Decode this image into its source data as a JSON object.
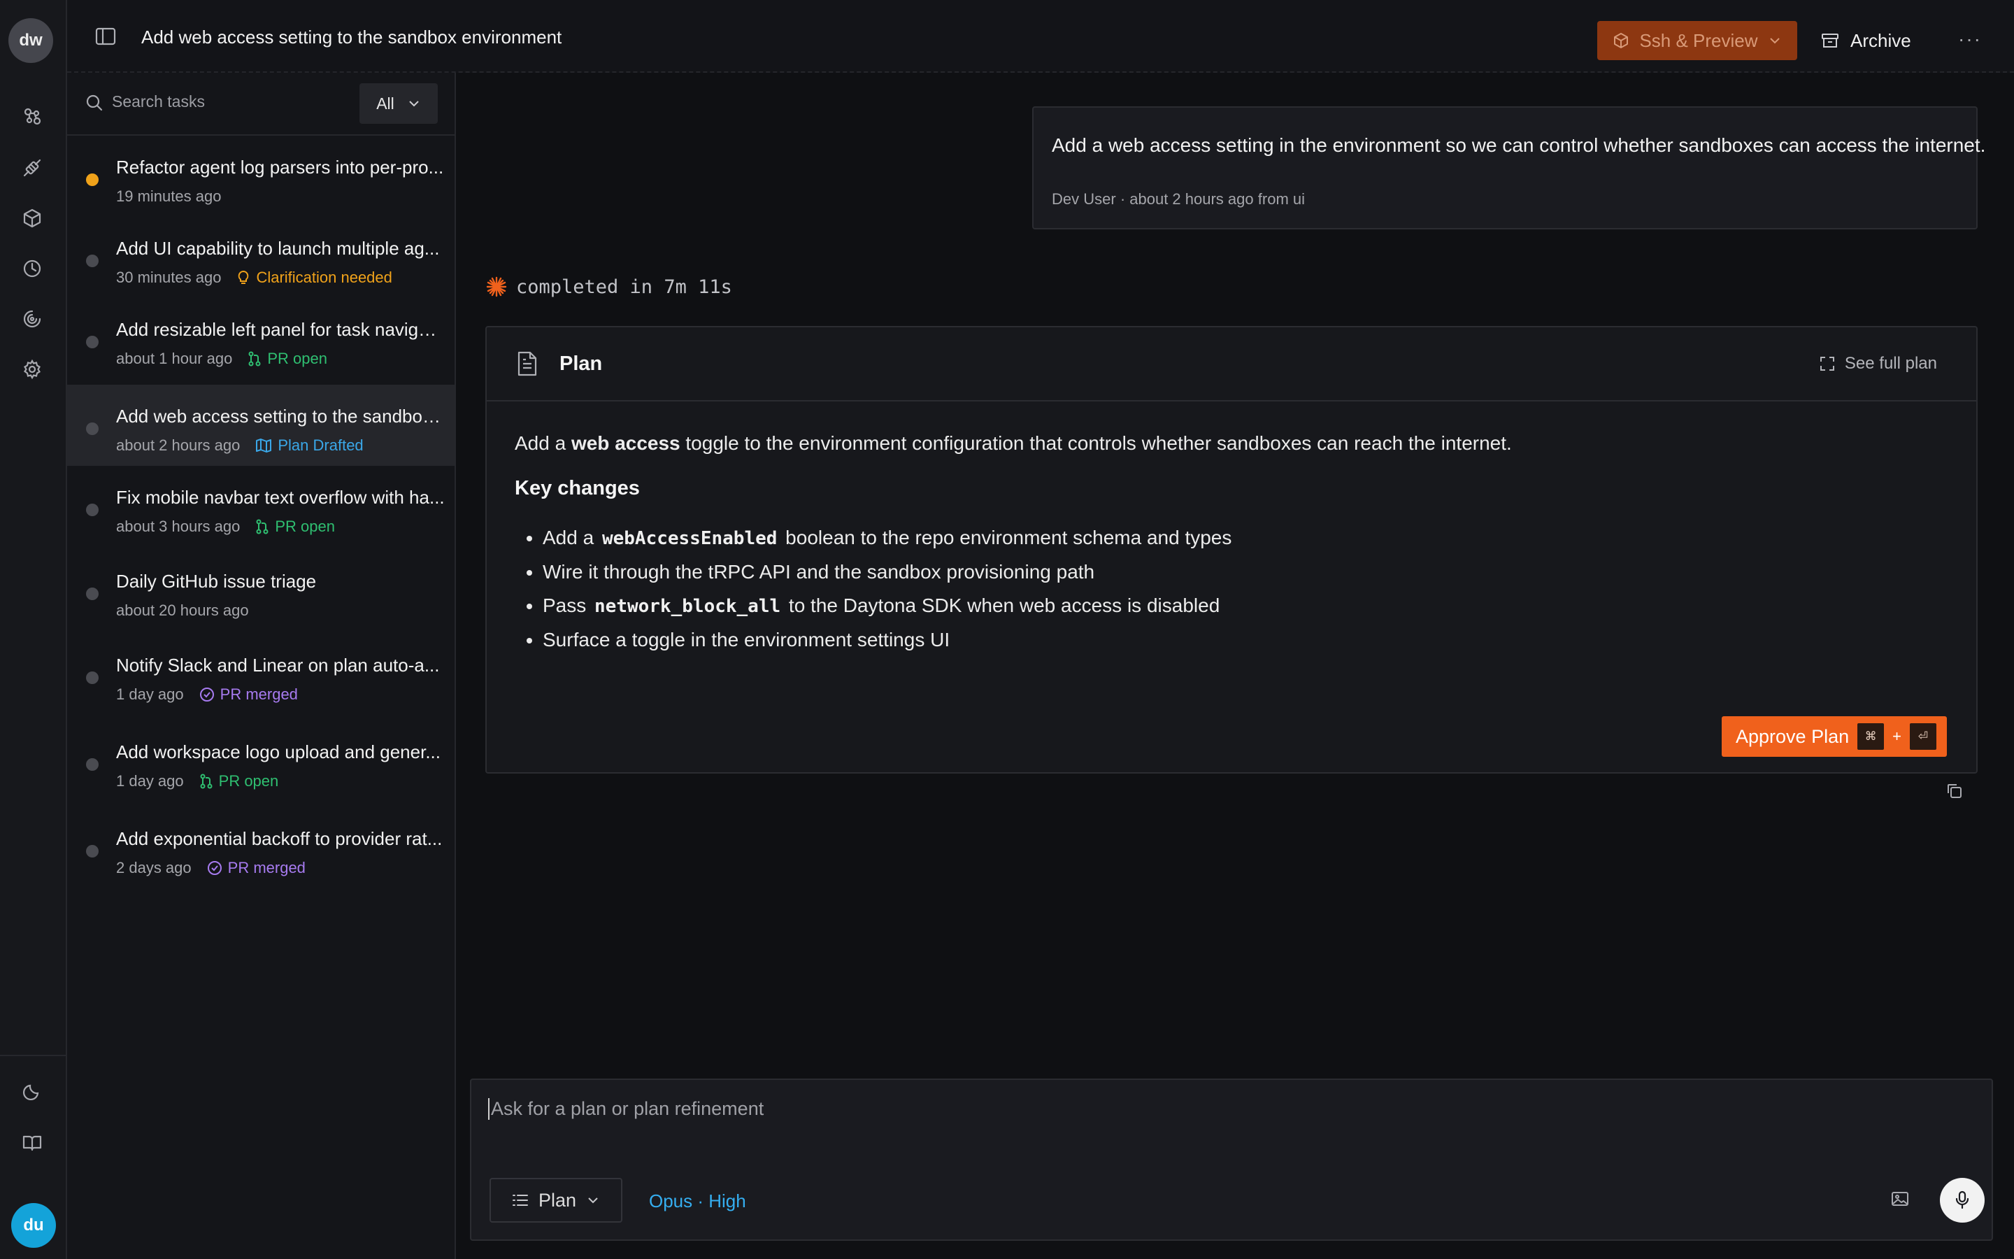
{
  "rail": {
    "top_avatar": "dw",
    "bottom_avatar": "du",
    "icons": [
      "agents-icon",
      "integrations-icon",
      "box-icon",
      "history-icon",
      "analytics-icon",
      "gear-icon",
      "moon-icon",
      "book-icon"
    ]
  },
  "header": {
    "title": "Add web access setting to the sandbox environment",
    "ssh_label": "Ssh & Preview",
    "archive_label": "Archive",
    "more_label": "···"
  },
  "search": {
    "placeholder": "Search tasks",
    "filter": "All"
  },
  "tasks": [
    {
      "title": "Refactor agent log parsers into per-pro...",
      "time": "19 minutes ago",
      "badge": "",
      "status": "running"
    },
    {
      "title": "Add UI capability to launch multiple ag...",
      "time": "30 minutes ago",
      "badge": "Clarification needed",
      "status": "idle"
    },
    {
      "title": "Add resizable left panel for task navigat...",
      "time": "about 1 hour ago",
      "badge": "PR open",
      "status": "idle"
    },
    {
      "title": "Add web access setting to the sandbox...",
      "time": "about 2 hours ago",
      "badge": "Plan Drafted",
      "status": "idle"
    },
    {
      "title": "Fix mobile navbar text overflow with ha...",
      "time": "about 3 hours ago",
      "badge": "PR open",
      "status": "idle"
    },
    {
      "title": "Daily GitHub issue triage",
      "time": "about 20 hours ago",
      "badge": "",
      "status": "idle"
    },
    {
      "title": "Notify Slack and Linear on plan auto-a...",
      "time": "1 day ago",
      "badge": "PR merged",
      "status": "idle"
    },
    {
      "title": "Add workspace logo upload and gener...",
      "time": "1 day ago",
      "badge": "PR open",
      "status": "idle"
    },
    {
      "title": "Add exponential backoff to provider rat...",
      "time": "2 days ago",
      "badge": "PR merged",
      "status": "idle"
    }
  ],
  "colors": {
    "accent": "#f0611c",
    "running": "#f0a21a",
    "clarification": "#f0a21a",
    "pr_open": "#2fbf71",
    "plan_drafted": "#3aa7e8",
    "pr_merged": "#a77bf0",
    "model": "#35aef0"
  },
  "message": {
    "text": "Add a web access setting in the environment so we can control whether sandboxes can access the internet.",
    "author": "Dev User",
    "time": "about 2 hours ago",
    "source": "from ui"
  },
  "status": {
    "text": "completed in 7m 11s"
  },
  "plan": {
    "title": "Plan",
    "see_full": "See full plan",
    "intro_prefix": "Add a ",
    "intro_bold": "web access",
    "intro_suffix": " toggle to the environment configuration that controls whether sandboxes can reach the internet.",
    "heading": "Key changes",
    "items": [
      {
        "before": "Add a ",
        "code": "webAccessEnabled",
        "after": " boolean to the repo environment schema and types"
      },
      {
        "before": "Wire it through the tRPC API and the sandbox provisioning path",
        "code": "",
        "after": ""
      },
      {
        "before": "Pass ",
        "code": "network_block_all",
        "after": " to the Daytona SDK when web access is disabled"
      },
      {
        "before": "Surface a toggle in the environment settings UI",
        "code": "",
        "after": ""
      }
    ],
    "approve_label": "Approve Plan",
    "shortcut_key1": "⌘",
    "shortcut_plus": "+",
    "shortcut_key2": "⏎"
  },
  "composer": {
    "placeholder": "Ask for a plan or plan refinement",
    "mode": "Plan",
    "model": "Opus · High"
  }
}
